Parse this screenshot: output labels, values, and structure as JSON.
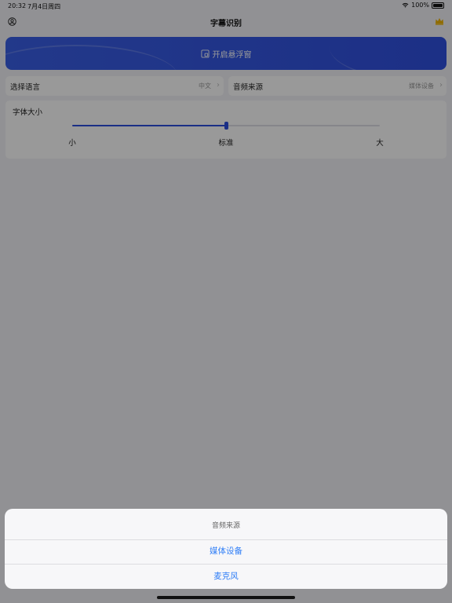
{
  "status_bar": {
    "time": "20:32",
    "date": "7月4日周四",
    "battery": "100%"
  },
  "nav": {
    "title": "字幕识别",
    "left_icon": "user-icon",
    "right_icon": "crown-icon"
  },
  "banner": {
    "label": "开启悬浮窗",
    "icon": "floating-window-icon"
  },
  "language": {
    "label": "选择语言",
    "value": "中文"
  },
  "audio_source": {
    "label": "音频来源",
    "value": "媒体设备"
  },
  "font_size": {
    "title": "字体大小",
    "ticks": [
      "小",
      "标准",
      "大"
    ],
    "level": 0.5
  },
  "action_sheet": {
    "title": "音频来源",
    "options": [
      "媒体设备",
      "麦克风"
    ]
  },
  "colors": {
    "accent": "#2e4fe0",
    "link": "#2f7ef7",
    "crown": "#f0b400"
  }
}
